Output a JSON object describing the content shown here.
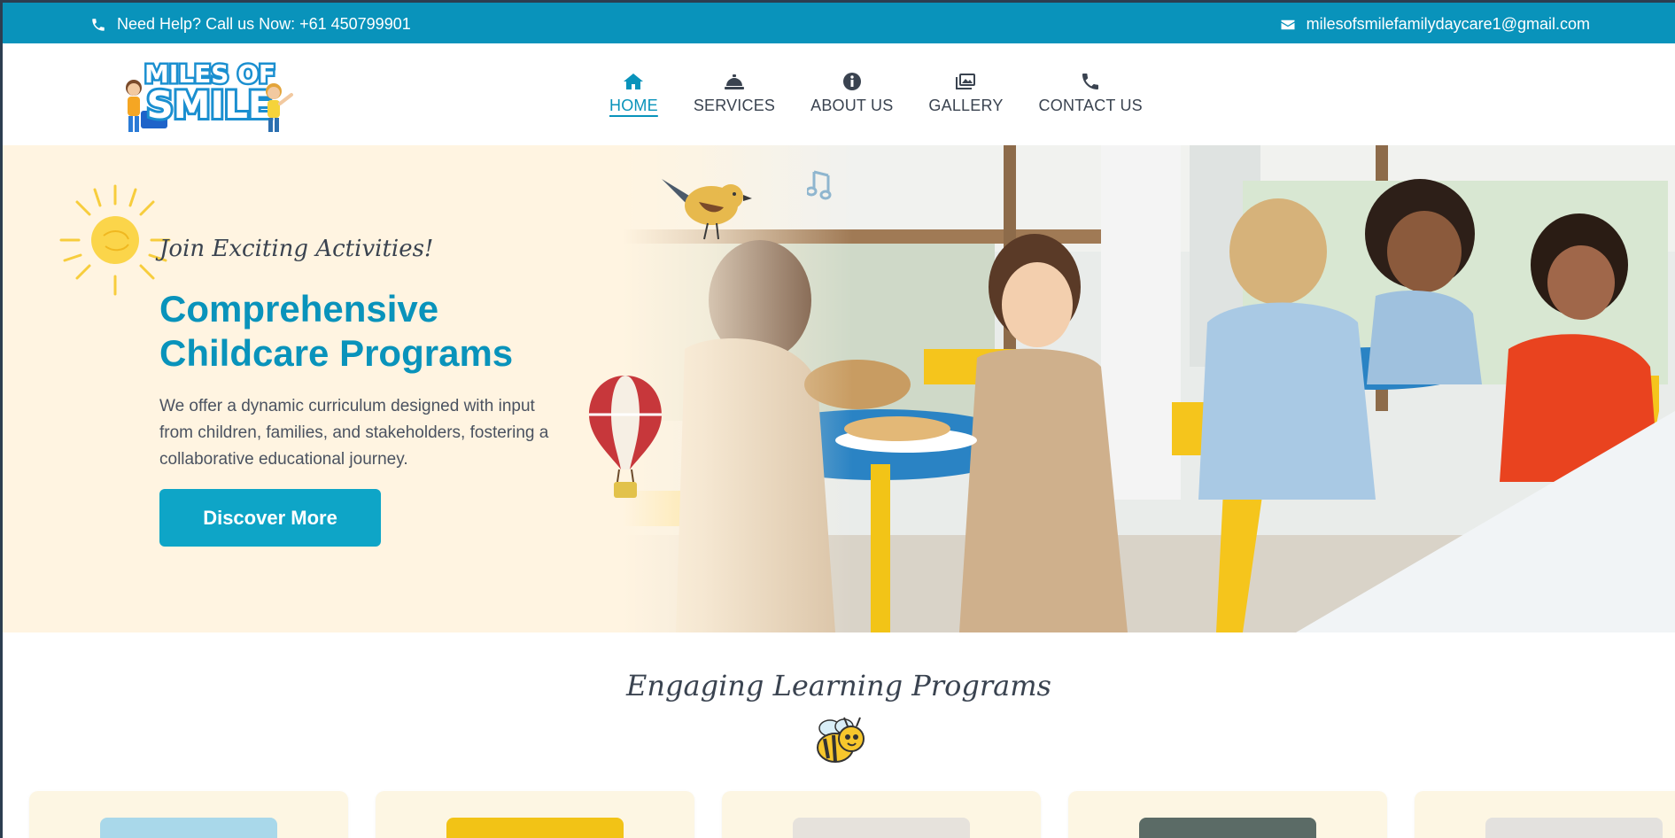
{
  "topbar": {
    "phone_text": "Need Help? Call us Now: +61 450799901",
    "email_text": "milesofsmilefamilydaycare1@gmail.com"
  },
  "logo": {
    "alt": "Miles of Smile"
  },
  "nav": [
    {
      "label": "HOME",
      "icon": "home-icon",
      "active": true
    },
    {
      "label": "SERVICES",
      "icon": "service-bell-icon",
      "active": false
    },
    {
      "label": "ABOUT US",
      "icon": "info-icon",
      "active": false
    },
    {
      "label": "GALLERY",
      "icon": "images-icon",
      "active": false
    },
    {
      "label": "CONTACT US",
      "icon": "phone-icon",
      "active": false
    }
  ],
  "hero": {
    "tagline": "Join Exciting Activities!",
    "headline_line1": "Comprehensive",
    "headline_line2": "Childcare Programs",
    "description": "We offer a dynamic curriculum designed with input from children, families, and stakeholders, fostering a collaborative educational journey.",
    "cta_label": "Discover More"
  },
  "programs": {
    "title": "Engaging Learning Programs"
  },
  "colors": {
    "primary": "#0993bb",
    "hero_bg": "#fff4e1",
    "card_bg": "#fdf6e3",
    "text": "#3a4350"
  }
}
